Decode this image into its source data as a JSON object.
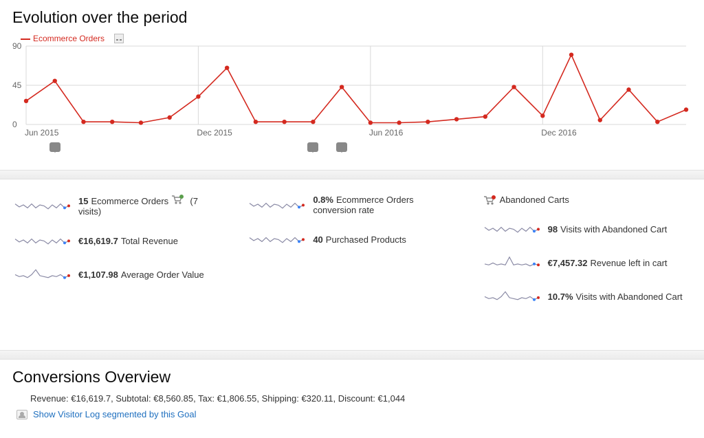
{
  "sections": {
    "evolution_title": "Evolution over the period",
    "conversions_title": "Conversions Overview"
  },
  "legend": {
    "series_name": "Ecommerce Orders"
  },
  "chart_data": {
    "type": "line",
    "title": "Evolution over the period",
    "xlabel": "",
    "ylabel": "",
    "ylim": [
      0,
      90
    ],
    "yticks": [
      0,
      45,
      90
    ],
    "x_tick_labels": [
      "Jun 2015",
      "Dec 2015",
      "Jun 2016",
      "Dec 2016"
    ],
    "x_tick_indices": [
      0,
      6,
      12,
      18
    ],
    "series": [
      {
        "name": "Ecommerce Orders",
        "color": "#d4291f",
        "values": [
          27,
          50,
          3,
          3,
          2,
          8,
          32,
          65,
          3,
          3,
          3,
          43,
          2,
          2,
          3,
          6,
          9,
          43,
          10,
          80,
          5,
          40,
          3,
          17
        ]
      }
    ],
    "annotations_at_index": [
      1,
      10,
      11
    ]
  },
  "metrics": {
    "left": [
      {
        "value": "15",
        "label": "Ecommerce Orders",
        "extra": "(7 visits)",
        "cart_icon": true
      },
      {
        "value": "€16,619.7",
        "label": "Total Revenue"
      },
      {
        "value": "€1,107.98",
        "label": "Average Order Value"
      }
    ],
    "middle": [
      {
        "value": "0.8%",
        "label": "Ecommerce Orders conversion rate"
      },
      {
        "value": "40",
        "label": "Purchased Products"
      }
    ],
    "right_title": "Abandoned Carts",
    "right": [
      {
        "value": "98",
        "label": "Visits with Abandoned Cart"
      },
      {
        "value": "€7,457.32",
        "label": "Revenue left in cart"
      },
      {
        "value": "10.7%",
        "label": "Visits with Abandoned Cart"
      }
    ]
  },
  "conversions": {
    "line_prefix": "Revenue: ",
    "revenue": "€16,619.7",
    "subtotal_prefix": ", Subtotal: ",
    "subtotal": "€8,560.85",
    "tax_prefix": ", Tax: ",
    "tax": "€1,806.55",
    "shipping_prefix": ", Shipping: ",
    "shipping": "€320.11",
    "discount_prefix": ", Discount: ",
    "discount": "€1,044",
    "link_text": "Show Visitor Log segmented by this Goal"
  },
  "sparkline_shapes": {
    "a": [
      6,
      9,
      7,
      10,
      6,
      10,
      7,
      8,
      11,
      7,
      10,
      6,
      10,
      8
    ],
    "b": [
      8,
      10,
      9,
      11,
      8,
      3,
      9,
      10,
      11,
      9,
      10,
      8,
      11,
      9
    ],
    "c": [
      9,
      10,
      8,
      10,
      9,
      10,
      2,
      10,
      9,
      10,
      9,
      11,
      9,
      10
    ]
  }
}
